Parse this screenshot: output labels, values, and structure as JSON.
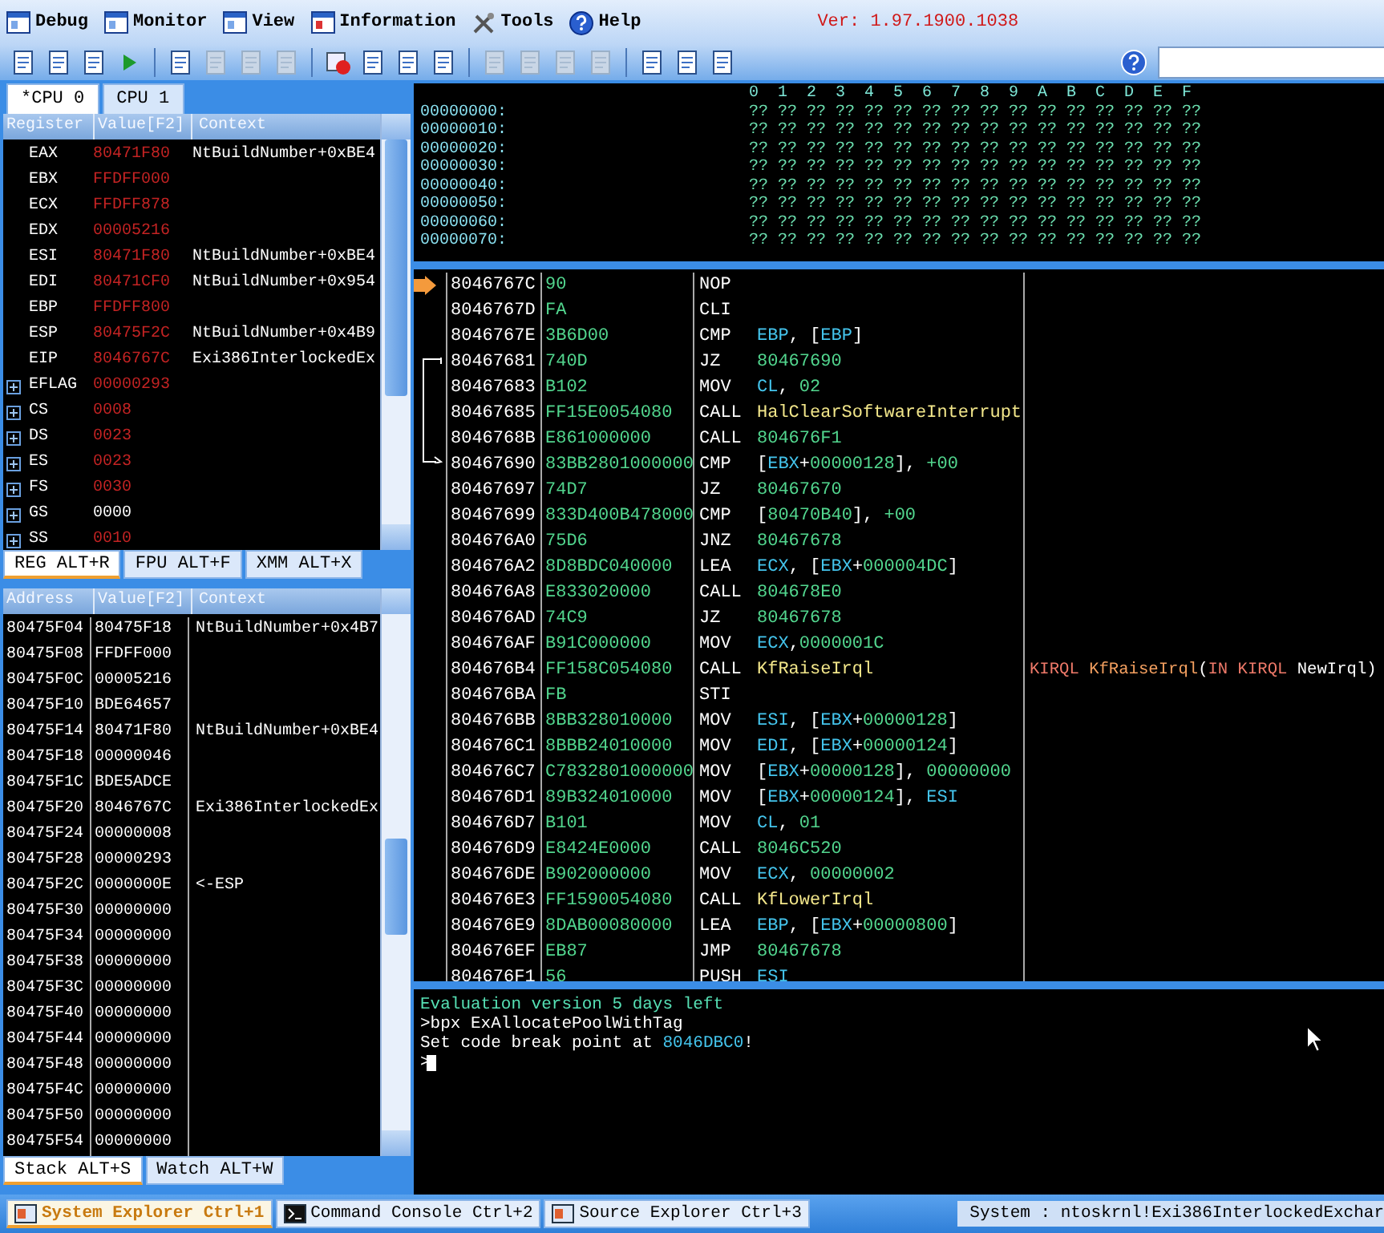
{
  "menu": [
    {
      "label": "Debug"
    },
    {
      "label": "Monitor"
    },
    {
      "label": "View"
    },
    {
      "label": "Information"
    },
    {
      "label": "Tools"
    },
    {
      "label": "Help"
    }
  ],
  "version": "Ver: 1.97.1900.1038",
  "toolbar": [
    {
      "kind": "button",
      "disabled": false
    },
    {
      "kind": "button",
      "disabled": false
    },
    {
      "kind": "button",
      "disabled": false
    },
    {
      "kind": "play",
      "disabled": false
    },
    {
      "kind": "separator"
    },
    {
      "kind": "button",
      "disabled": false
    },
    {
      "kind": "button",
      "disabled": true
    },
    {
      "kind": "button",
      "disabled": true
    },
    {
      "kind": "button",
      "disabled": true
    },
    {
      "kind": "separator"
    },
    {
      "kind": "stop",
      "disabled": false
    },
    {
      "kind": "button",
      "disabled": false
    },
    {
      "kind": "button",
      "disabled": false
    },
    {
      "kind": "button",
      "disabled": false
    },
    {
      "kind": "separator"
    },
    {
      "kind": "button",
      "disabled": true
    },
    {
      "kind": "button",
      "disabled": true
    },
    {
      "kind": "button",
      "disabled": true
    },
    {
      "kind": "button",
      "disabled": true
    },
    {
      "kind": "separator"
    },
    {
      "kind": "button",
      "disabled": false
    },
    {
      "kind": "button",
      "disabled": false
    },
    {
      "kind": "button",
      "disabled": false
    }
  ],
  "cpu_tabs": [
    {
      "label": "*CPU 0",
      "selected": true
    },
    {
      "label": "CPU 1",
      "selected": false
    }
  ],
  "registers": {
    "columns": [
      "Register",
      "Value[F2]",
      "Context"
    ],
    "rows": [
      {
        "kind": "register",
        "name": "EAX",
        "value": "80471F80",
        "changed": true,
        "context": "NtBuildNumber+0xBE4"
      },
      {
        "kind": "register",
        "name": "EBX",
        "value": "FFDFF000",
        "changed": true
      },
      {
        "kind": "register",
        "name": "ECX",
        "value": "FFDFF878",
        "changed": true
      },
      {
        "kind": "register",
        "name": "EDX",
        "value": "00005216",
        "changed": true
      },
      {
        "kind": "register",
        "name": "ESI",
        "value": "80471F80",
        "changed": true,
        "context": "NtBuildNumber+0xBE4"
      },
      {
        "kind": "register",
        "name": "EDI",
        "value": "80471CF0",
        "changed": true,
        "context": "NtBuildNumber+0x954"
      },
      {
        "kind": "register",
        "name": "EBP",
        "value": "FFDFF800",
        "changed": true
      },
      {
        "kind": "register",
        "name": "ESP",
        "value": "80475F2C",
        "changed": true,
        "context": "NtBuildNumber+0x4B9"
      },
      {
        "kind": "register",
        "name": "EIP",
        "value": "8046767C",
        "changed": true,
        "context": "Exi386InterlockedEx"
      },
      {
        "kind": "expandable",
        "name": "EFLAG",
        "value": "00000293",
        "changed": true
      },
      {
        "kind": "expandable",
        "name": "CS",
        "value": "0008",
        "changed": true
      },
      {
        "kind": "expandable",
        "name": "DS",
        "value": "0023",
        "changed": true
      },
      {
        "kind": "expandable",
        "name": "ES",
        "value": "0023",
        "changed": true
      },
      {
        "kind": "expandable",
        "name": "FS",
        "value": "0030",
        "changed": true
      },
      {
        "kind": "expandable",
        "name": "GS",
        "value": "0000",
        "changed": false
      },
      {
        "kind": "expandable",
        "name": "SS",
        "value": "0010",
        "changed": true
      }
    ]
  },
  "register_tabs": [
    {
      "label": "REG ALT+R",
      "selected": true
    },
    {
      "label": "FPU ALT+F",
      "selected": false
    },
    {
      "label": "XMM ALT+X",
      "selected": false
    }
  ],
  "stack": {
    "columns": [
      "Address",
      "Value[F2]",
      "Context"
    ],
    "rows": [
      {
        "address": "80475F04",
        "value": "80475F18",
        "context": "NtBuildNumber+0x4B7"
      },
      {
        "address": "80475F08",
        "value": "FFDFF000"
      },
      {
        "address": "80475F0C",
        "value": "00005216"
      },
      {
        "address": "80475F10",
        "value": "BDE64657"
      },
      {
        "address": "80475F14",
        "value": "80471F80",
        "context": "NtBuildNumber+0xBE4"
      },
      {
        "address": "80475F18",
        "value": "00000046"
      },
      {
        "address": "80475F1C",
        "value": "BDE5ADCE"
      },
      {
        "address": "80475F20",
        "value": "8046767C",
        "context": "Exi386InterlockedEx"
      },
      {
        "address": "80475F24",
        "value": "00000008"
      },
      {
        "address": "80475F28",
        "value": "00000293"
      },
      {
        "address": "80475F2C",
        "value": "0000000E",
        "context": "<-ESP"
      },
      {
        "address": "80475F30",
        "value": "00000000"
      },
      {
        "address": "80475F34",
        "value": "00000000"
      },
      {
        "address": "80475F38",
        "value": "00000000"
      },
      {
        "address": "80475F3C",
        "value": "00000000"
      },
      {
        "address": "80475F40",
        "value": "00000000"
      },
      {
        "address": "80475F44",
        "value": "00000000"
      },
      {
        "address": "80475F48",
        "value": "00000000"
      },
      {
        "address": "80475F4C",
        "value": "00000000"
      },
      {
        "address": "80475F50",
        "value": "00000000"
      },
      {
        "address": "80475F54",
        "value": "00000000"
      }
    ]
  },
  "stack_tabs": [
    {
      "label": "Stack ALT+S",
      "selected": true
    },
    {
      "label": "Watch ALT+W",
      "selected": false
    }
  ],
  "memory": {
    "columns": [
      "0",
      "1",
      "2",
      "3",
      "4",
      "5",
      "6",
      "7",
      "8",
      "9",
      "A",
      "B",
      "C",
      "D",
      "E",
      "F"
    ],
    "rows": [
      {
        "address": "00000000:",
        "bytes": [
          "??",
          "??",
          "??",
          "??",
          "??",
          "??",
          "??",
          "??",
          "??",
          "??",
          "??",
          "??",
          "??",
          "??",
          "??",
          "??"
        ]
      },
      {
        "address": "00000010:",
        "bytes": [
          "??",
          "??",
          "??",
          "??",
          "??",
          "??",
          "??",
          "??",
          "??",
          "??",
          "??",
          "??",
          "??",
          "??",
          "??",
          "??"
        ]
      },
      {
        "address": "00000020:",
        "bytes": [
          "??",
          "??",
          "??",
          "??",
          "??",
          "??",
          "??",
          "??",
          "??",
          "??",
          "??",
          "??",
          "??",
          "??",
          "??",
          "??"
        ]
      },
      {
        "address": "00000030:",
        "bytes": [
          "??",
          "??",
          "??",
          "??",
          "??",
          "??",
          "??",
          "??",
          "??",
          "??",
          "??",
          "??",
          "??",
          "??",
          "??",
          "??"
        ]
      },
      {
        "address": "00000040:",
        "bytes": [
          "??",
          "??",
          "??",
          "??",
          "??",
          "??",
          "??",
          "??",
          "??",
          "??",
          "??",
          "??",
          "??",
          "??",
          "??",
          "??"
        ]
      },
      {
        "address": "00000050:",
        "bytes": [
          "??",
          "??",
          "??",
          "??",
          "??",
          "??",
          "??",
          "??",
          "??",
          "??",
          "??",
          "??",
          "??",
          "??",
          "??",
          "??"
        ]
      },
      {
        "address": "00000060:",
        "bytes": [
          "??",
          "??",
          "??",
          "??",
          "??",
          "??",
          "??",
          "??",
          "??",
          "??",
          "??",
          "??",
          "??",
          "??",
          "??",
          "??"
        ]
      },
      {
        "address": "00000070:",
        "bytes": [
          "??",
          "??",
          "??",
          "??",
          "??",
          "??",
          "??",
          "??",
          "??",
          "??",
          "??",
          "??",
          "??",
          "??",
          "??",
          "??"
        ]
      }
    ]
  },
  "disassembly": [
    {
      "address": "8046767C",
      "bytes": "90",
      "mnemonic": "NOP",
      "current": true
    },
    {
      "address": "8046767D",
      "bytes": "FA",
      "mnemonic": "CLI",
      "current": false
    },
    {
      "address": "8046767E",
      "bytes": "3B6D00",
      "mnemonic": "CMP",
      "current": false,
      "operands": [
        {
          "kind": "r",
          "t": "EBP"
        },
        {
          "kind": "p",
          "t": ", ["
        },
        {
          "kind": "r",
          "t": "EBP"
        },
        {
          "kind": "p",
          "t": "]"
        }
      ]
    },
    {
      "kind": "jump_source",
      "address": "80467681",
      "bytes": "740D",
      "mnemonic": "JZ",
      "current": false,
      "operands": [
        {
          "kind": "n",
          "t": "80467690"
        }
      ]
    },
    {
      "address": "80467683",
      "bytes": "B102",
      "mnemonic": "MOV",
      "current": false,
      "operands": [
        {
          "kind": "r",
          "t": "CL"
        },
        {
          "kind": "p",
          "t": ", "
        },
        {
          "kind": "n",
          "t": "02"
        }
      ]
    },
    {
      "address": "80467685",
      "bytes": "FF15E0054080",
      "mnemonic": "CALL",
      "current": false,
      "operands": [
        {
          "kind": "s",
          "t": "HalClearSoftwareInterrupt"
        }
      ]
    },
    {
      "address": "8046768B",
      "bytes": "E861000000",
      "mnemonic": "CALL",
      "current": false,
      "operands": [
        {
          "kind": "n",
          "t": "804676F1"
        }
      ]
    },
    {
      "kind": "jump_target",
      "address": "80467690",
      "bytes": "83BB2801000000",
      "mnemonic": "CMP",
      "current": false,
      "operands": [
        {
          "kind": "p",
          "t": "["
        },
        {
          "kind": "r",
          "t": "EBX"
        },
        {
          "kind": "p",
          "t": "+"
        },
        {
          "kind": "n",
          "t": "00000128"
        },
        {
          "kind": "p",
          "t": "], "
        },
        {
          "kind": "n",
          "t": "+00"
        }
      ]
    },
    {
      "address": "80467697",
      "bytes": "74D7",
      "mnemonic": "JZ",
      "current": false,
      "operands": [
        {
          "kind": "n",
          "t": "80467670"
        }
      ]
    },
    {
      "address": "80467699",
      "bytes": "833D400B478000",
      "mnemonic": "CMP",
      "current": false,
      "operands": [
        {
          "kind": "p",
          "t": "["
        },
        {
          "kind": "n",
          "t": "80470B40"
        },
        {
          "kind": "p",
          "t": "], "
        },
        {
          "kind": "n",
          "t": "+00"
        }
      ]
    },
    {
      "address": "804676A0",
      "bytes": "75D6",
      "mnemonic": "JNZ",
      "current": false,
      "operands": [
        {
          "kind": "n",
          "t": "80467678"
        }
      ]
    },
    {
      "address": "804676A2",
      "bytes": "8D8BDC040000",
      "mnemonic": "LEA",
      "current": false,
      "operands": [
        {
          "kind": "r",
          "t": "ECX"
        },
        {
          "kind": "p",
          "t": ", ["
        },
        {
          "kind": "r",
          "t": "EBX"
        },
        {
          "kind": "p",
          "t": "+"
        },
        {
          "kind": "n",
          "t": "000004DC"
        },
        {
          "kind": "p",
          "t": "]"
        }
      ]
    },
    {
      "address": "804676A8",
      "bytes": "E833020000",
      "mnemonic": "CALL",
      "current": false,
      "operands": [
        {
          "kind": "n",
          "t": "804678E0"
        }
      ]
    },
    {
      "address": "804676AD",
      "bytes": "74C9",
      "mnemonic": "JZ",
      "current": false,
      "operands": [
        {
          "kind": "n",
          "t": "80467678"
        }
      ]
    },
    {
      "address": "804676AF",
      "bytes": "B91C000000",
      "mnemonic": "MOV",
      "current": false,
      "operands": [
        {
          "kind": "r",
          "t": "ECX"
        },
        {
          "kind": "p",
          "t": ","
        },
        {
          "kind": "n",
          "t": "0000001C"
        }
      ]
    },
    {
      "address": "804676B4",
      "bytes": "FF158C054080",
      "mnemonic": "CALL",
      "current": false,
      "operands": [
        {
          "kind": "s",
          "t": "KfRaiseIrql"
        }
      ],
      "comment": [
        {
          "kind": "type",
          "t": "KIRQL "
        },
        {
          "kind": "fn",
          "t": "KfRaiseIrql"
        },
        {
          "kind": "p",
          "t": "("
        },
        {
          "kind": "type",
          "t": "IN KIRQL "
        },
        {
          "kind": "p",
          "t": "NewIrql)"
        }
      ]
    },
    {
      "address": "804676BA",
      "bytes": "FB",
      "mnemonic": "STI",
      "current": false
    },
    {
      "address": "804676BB",
      "bytes": "8BB328010000",
      "mnemonic": "MOV",
      "current": false,
      "operands": [
        {
          "kind": "r",
          "t": "ESI"
        },
        {
          "kind": "p",
          "t": ", ["
        },
        {
          "kind": "r",
          "t": "EBX"
        },
        {
          "kind": "p",
          "t": "+"
        },
        {
          "kind": "n",
          "t": "00000128"
        },
        {
          "kind": "p",
          "t": "]"
        }
      ]
    },
    {
      "address": "804676C1",
      "bytes": "8BBB24010000",
      "mnemonic": "MOV",
      "current": false,
      "operands": [
        {
          "kind": "r",
          "t": "EDI"
        },
        {
          "kind": "p",
          "t": ", ["
        },
        {
          "kind": "r",
          "t": "EBX"
        },
        {
          "kind": "p",
          "t": "+"
        },
        {
          "kind": "n",
          "t": "00000124"
        },
        {
          "kind": "p",
          "t": "]"
        }
      ]
    },
    {
      "address": "804676C7",
      "bytes": "C7832801000000",
      "mnemonic": "MOV",
      "current": false,
      "operands": [
        {
          "kind": "p",
          "t": "["
        },
        {
          "kind": "r",
          "t": "EBX"
        },
        {
          "kind": "p",
          "t": "+"
        },
        {
          "kind": "n",
          "t": "00000128"
        },
        {
          "kind": "p",
          "t": "], "
        },
        {
          "kind": "n",
          "t": "00000000"
        }
      ]
    },
    {
      "address": "804676D1",
      "bytes": "89B324010000",
      "mnemonic": "MOV",
      "current": false,
      "operands": [
        {
          "kind": "p",
          "t": "["
        },
        {
          "kind": "r",
          "t": "EBX"
        },
        {
          "kind": "p",
          "t": "+"
        },
        {
          "kind": "n",
          "t": "00000124"
        },
        {
          "kind": "p",
          "t": "], "
        },
        {
          "kind": "r",
          "t": "ESI"
        }
      ]
    },
    {
      "address": "804676D7",
      "bytes": "B101",
      "mnemonic": "MOV",
      "current": false,
      "operands": [
        {
          "kind": "r",
          "t": "CL"
        },
        {
          "kind": "p",
          "t": ", "
        },
        {
          "kind": "n",
          "t": "01"
        }
      ]
    },
    {
      "address": "804676D9",
      "bytes": "E8424E0000",
      "mnemonic": "CALL",
      "current": false,
      "operands": [
        {
          "kind": "n",
          "t": "8046C520"
        }
      ]
    },
    {
      "address": "804676DE",
      "bytes": "B902000000",
      "mnemonic": "MOV",
      "current": false,
      "operands": [
        {
          "kind": "r",
          "t": "ECX"
        },
        {
          "kind": "p",
          "t": ", "
        },
        {
          "kind": "n",
          "t": "00000002"
        }
      ]
    },
    {
      "address": "804676E3",
      "bytes": "FF1590054080",
      "mnemonic": "CALL",
      "current": false,
      "operands": [
        {
          "kind": "s",
          "t": "KfLowerIrql"
        }
      ]
    },
    {
      "address": "804676E9",
      "bytes": "8DAB00080000",
      "mnemonic": "LEA",
      "current": false,
      "operands": [
        {
          "kind": "r",
          "t": "EBP"
        },
        {
          "kind": "p",
          "t": ", ["
        },
        {
          "kind": "r",
          "t": "EBX"
        },
        {
          "kind": "p",
          "t": "+"
        },
        {
          "kind": "n",
          "t": "00000800"
        },
        {
          "kind": "p",
          "t": "]"
        }
      ]
    },
    {
      "address": "804676EF",
      "bytes": "EB87",
      "mnemonic": "JMP",
      "current": false,
      "operands": [
        {
          "kind": "n",
          "t": "80467678"
        }
      ]
    },
    {
      "address": "804676F1",
      "bytes": "56",
      "mnemonic": "PUSH",
      "current": false,
      "operands": [
        {
          "kind": "r",
          "t": "ESI"
        }
      ]
    }
  ],
  "console": {
    "lines": [
      {
        "kind": "info",
        "parts": [
          {
            "kind": "plain",
            "t": "Evaluation version 5 days left"
          }
        ]
      },
      {
        "kind": "command",
        "parts": [
          {
            "kind": "plain",
            "t": ">bpx ExAllocatePoolWithTag"
          }
        ]
      },
      {
        "kind": "output",
        "parts": [
          {
            "kind": "plain",
            "t": "Set code break point at "
          },
          {
            "kind": "addr",
            "t": "8046DBC0"
          },
          {
            "kind": "plain",
            "t": "!"
          }
        ]
      }
    ],
    "prompt": ">"
  },
  "bottom_tabs": [
    {
      "label": "System Explorer Ctrl+1",
      "selected": true
    },
    {
      "label": "Command Console Ctrl+2",
      "selected": false
    },
    {
      "label": "Source Explorer Ctrl+3",
      "selected": false
    }
  ],
  "status": "System : ntoskrnl!Exi386InterlockedExchar"
}
